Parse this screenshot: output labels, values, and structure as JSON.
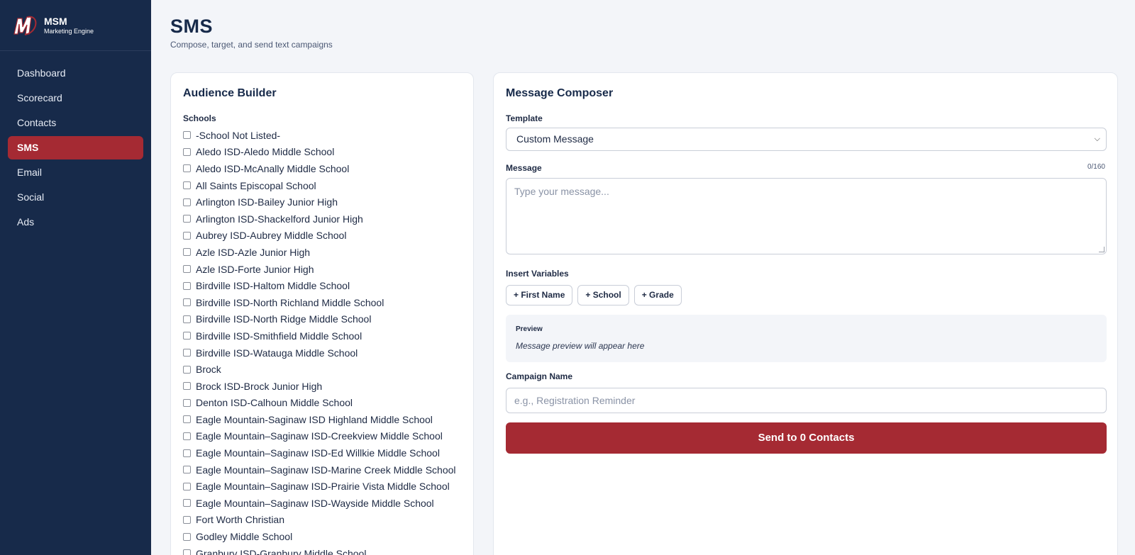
{
  "brand": {
    "name": "MSM",
    "subtitle": "Marketing Engine",
    "accent": "#a52a33",
    "sidebar_bg": "#172a4a"
  },
  "nav": [
    {
      "label": "Dashboard",
      "active": false
    },
    {
      "label": "Scorecard",
      "active": false
    },
    {
      "label": "Contacts",
      "active": false
    },
    {
      "label": "SMS",
      "active": true
    },
    {
      "label": "Email",
      "active": false
    },
    {
      "label": "Social",
      "active": false
    },
    {
      "label": "Ads",
      "active": false
    }
  ],
  "page": {
    "title": "SMS",
    "subtitle": "Compose, target, and send text campaigns"
  },
  "audience": {
    "title": "Audience Builder",
    "schools_label": "Schools",
    "schools": [
      "-School Not Listed-",
      "Aledo ISD-Aledo Middle School",
      "Aledo ISD-McAnally Middle School",
      "All Saints Episcopal School",
      "Arlington ISD-Bailey Junior High",
      "Arlington ISD-Shackelford Junior High",
      "Aubrey ISD-Aubrey Middle School",
      "Azle ISD-Azle Junior High",
      "Azle ISD-Forte Junior High",
      "Birdville ISD-Haltom Middle School",
      "Birdville ISD-North Richland Middle School",
      "Birdville ISD-North Ridge Middle School",
      "Birdville ISD-Smithfield Middle School",
      "Birdville ISD-Watauga Middle School",
      "Brock",
      "Brock ISD-Brock Junior High",
      "Denton ISD-Calhoun Middle School",
      "Eagle Mountain-Saginaw ISD Highland Middle School",
      "Eagle Mountain–Saginaw ISD-Creekview Middle School",
      "Eagle Mountain–Saginaw ISD-Ed Willkie Middle School",
      "Eagle Mountain–Saginaw ISD-Marine Creek Middle School",
      "Eagle Mountain–Saginaw ISD-Prairie Vista Middle School",
      "Eagle Mountain–Saginaw ISD-Wayside Middle School",
      "Fort Worth Christian",
      "Godley Middle School",
      "Granbury ISD-Granbury Middle School"
    ]
  },
  "composer": {
    "title": "Message Composer",
    "template_label": "Template",
    "template_value": "Custom Message",
    "message_label": "Message",
    "counter": "0/160",
    "message_placeholder": "Type your message...",
    "variables_label": "Insert Variables",
    "variables": [
      "+ First Name",
      "+ School",
      "+ Grade"
    ],
    "preview_label": "Preview",
    "preview_text": "Message preview will appear here",
    "campaign_label": "Campaign Name",
    "campaign_placeholder": "e.g., Registration Reminder",
    "send_label": "Send to 0 Contacts"
  }
}
